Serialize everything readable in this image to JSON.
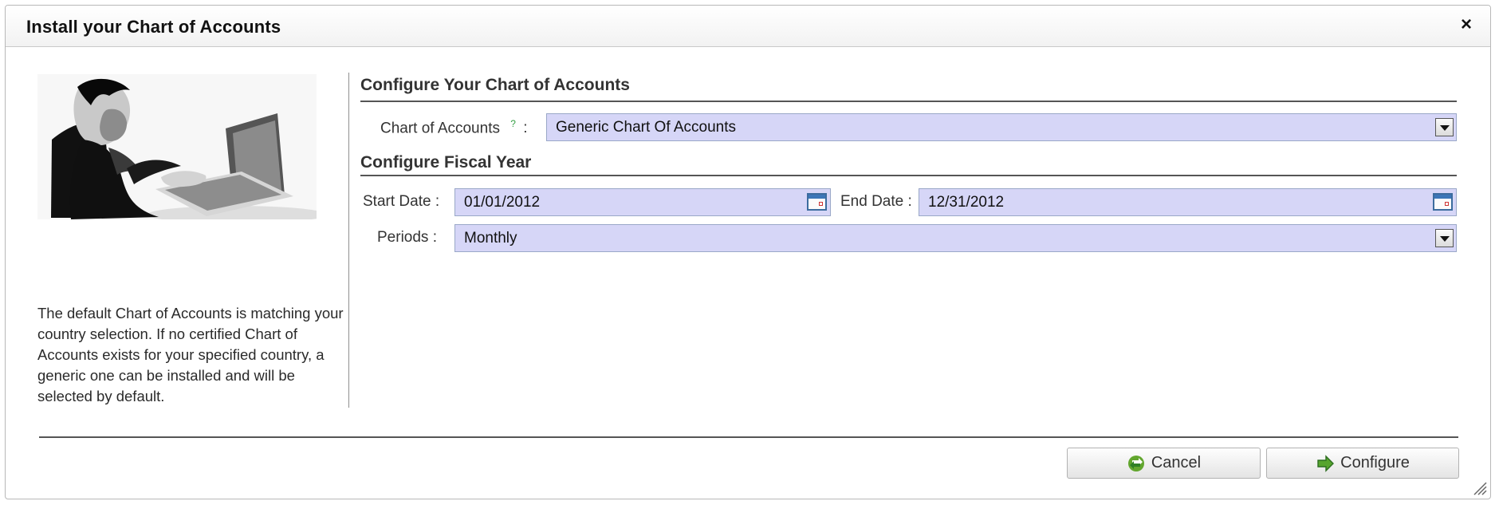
{
  "dialog": {
    "title": "Install your Chart of Accounts",
    "close_icon": "close-icon"
  },
  "left_panel": {
    "image": "person-with-laptop-photo",
    "help_text": "The default Chart of Accounts is matching your country selection. If no certified Chart of Accounts exists for your specified country, a generic one can be installed and will be selected by default."
  },
  "chart_section": {
    "title": "Configure Your Chart of Accounts",
    "chart_label": "Chart of Accounts",
    "help_marker": "?",
    "separator": ":",
    "chart_value": "Generic Chart Of Accounts"
  },
  "fiscal_section": {
    "title": "Configure Fiscal Year",
    "start_label": "Start Date :",
    "start_value": "01/01/2012",
    "end_label": "End Date :",
    "end_value": "12/31/2012",
    "periods_label": "Periods :",
    "periods_value": "Monthly"
  },
  "footer": {
    "cancel_label": "Cancel",
    "configure_label": "Configure"
  },
  "colors": {
    "field_background": "#d6d6f7",
    "cancel_icon": "#62a62e",
    "configure_icon": "#57a52e"
  }
}
